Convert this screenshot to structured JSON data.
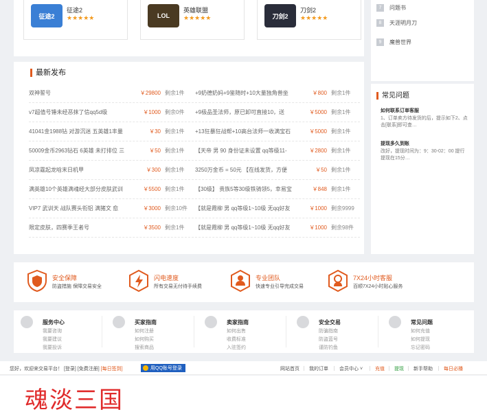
{
  "games": [
    {
      "name": "征途2",
      "stars": "★★★★★",
      "logo_text": "征途2",
      "color": "#3a7fd5"
    },
    {
      "name": "英雄联盟",
      "stars": "★★★★★",
      "logo_text": "LOL",
      "color": "#4a3a22"
    },
    {
      "name": "刀剑2",
      "stars": "★★★★★",
      "logo_text": "刀剑2",
      "color": "#2a2d3a"
    }
  ],
  "side_links": [
    {
      "num": "7",
      "label": "问题书"
    },
    {
      "num": "8",
      "label": "天涯明月刀"
    },
    {
      "num": "9",
      "label": "魔兽世界"
    }
  ],
  "latest": {
    "title": "最新发布",
    "left": [
      {
        "title": "双神誓号",
        "price": "￥29800",
        "stock": "剩余1件"
      },
      {
        "title": "v7超值号锤未经恶抹了信qq5d级",
        "price": "￥1000",
        "stock": "剩余0件"
      },
      {
        "title": "41041金1988钻 对游沉迷 五英雄1丰量",
        "price": "￥30",
        "stock": "剩余1件"
      },
      {
        "title": "50009金币2963钻石 6英雄 未打排位 三",
        "price": "￥50",
        "stock": "剩余1件"
      },
      {
        "title": "凤凉霆起龙晗末日机甲",
        "price": "￥300",
        "stock": "剩余1件"
      },
      {
        "title": "满英雄10个英雄满魂经大部分皮肤武训",
        "price": "￥5500",
        "stock": "剩余1件"
      },
      {
        "title": "VIP7 武训天 战队赛头衔铝 满猪文 愈",
        "price": "￥3000",
        "stock": "剩余10件"
      },
      {
        "title": "限定皮肤，四赛季王者号",
        "price": "￥3500",
        "stock": "剩余1件"
      }
    ],
    "right": [
      {
        "title": "+9奶德奶妈+9鉴随时+10大量独角兽坐",
        "price": "￥800",
        "stock": "剩余1件"
      },
      {
        "title": "+9极品圣法师，原已卸可直接10，送",
        "price": "￥5000",
        "stock": "剩余1件"
      },
      {
        "title": "+13狂暴狂战帮+10高台法师一收满宝石",
        "price": "￥5000",
        "stock": "剩余1件"
      },
      {
        "title": "【天帝 男 90 身份证未设置 qq等级11-",
        "price": "￥2800",
        "stock": "剩余1件"
      },
      {
        "title": "3250万金币 = 50元 【在线发货，方便",
        "price": "￥50",
        "stock": "剩余1件"
      },
      {
        "title": "【30级】 贵族5等30级铁骑领5，幸易宝",
        "price": "￥848",
        "stock": "剩余1件"
      },
      {
        "title": "【就是霞柳 男 qq等级1~10级 无qq好友",
        "price": "￥1000",
        "stock": "剩余9999"
      },
      {
        "title": "【就是霞柳 男 qq等级1~10级 无qq好友",
        "price": "￥1000",
        "stock": "剩余98件"
      }
    ]
  },
  "faq": {
    "title": "常见问题",
    "items": [
      {
        "q": "如何联系订单客服",
        "a": "1、订单卖方待发货的后，提示如下2、点击[联系]即可查…"
      },
      {
        "q": "提现多久到账",
        "a": "改好，提现时间为：9：30-02：00 提行提现在15分…"
      }
    ]
  },
  "guarantees": [
    {
      "title": "安全保障",
      "desc": "防盗措施 保障交易安全"
    },
    {
      "title": "闪电速度",
      "desc": "所有交易无付待手续费"
    },
    {
      "title": "专业团队",
      "desc": "快速专业引导完成交易"
    },
    {
      "title": "7X24小时客服",
      "desc": "百顺7X24小时贴心服务"
    }
  ],
  "footer_cols": [
    {
      "heading": "服务中心",
      "links": [
        "我要咨询",
        "我要建议",
        "我要投诉"
      ]
    },
    {
      "heading": "买家指南",
      "links": [
        "如何注册",
        "如何购买",
        "搜索商品"
      ]
    },
    {
      "heading": "卖家指南",
      "links": [
        "如何出售",
        "收费标准",
        "入驻签约"
      ]
    },
    {
      "heading": "安全交易",
      "links": [
        "防骗指南",
        "防盗蓝号",
        "谨防钓鱼"
      ]
    },
    {
      "heading": "常见问题",
      "links": [
        "如何充值",
        "如何提现",
        "忘记密码"
      ]
    }
  ],
  "topbar": {
    "welcome": "您好，欢迎来交易平台！",
    "login": "[登录]",
    "register": "[免费注册]",
    "signin": "[每日签到]",
    "qq_login": "用QQ账号登录",
    "links": [
      "网站首页",
      "我的订单",
      "会员中心 ˅",
      "充值",
      "提现",
      "新手帮助"
    ],
    "hot": "每日必播"
  },
  "brand": {
    "title": "魂淡三国"
  },
  "colors": {
    "accent": "#e05a1e",
    "brand": "#e02b2b"
  }
}
